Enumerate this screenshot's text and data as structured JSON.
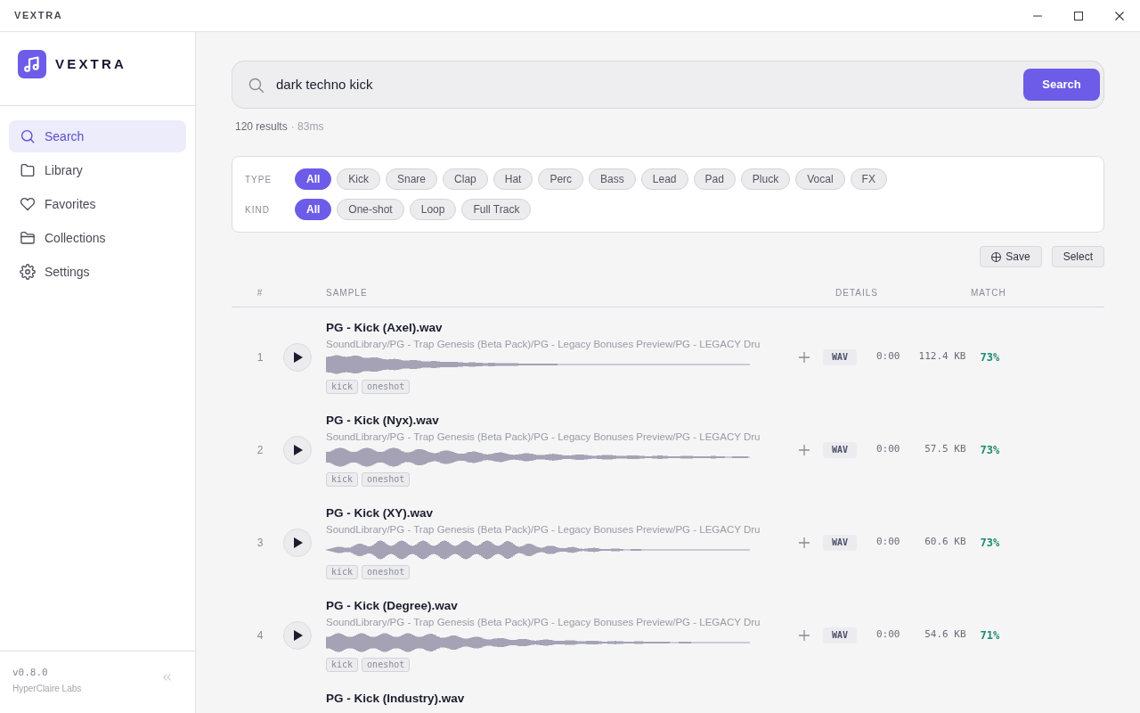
{
  "window": {
    "title": "VEXTRA"
  },
  "sidebar": {
    "brand": "VEXTRA",
    "items": [
      {
        "label": "Search",
        "selected": true
      },
      {
        "label": "Library",
        "selected": false
      },
      {
        "label": "Favorites",
        "selected": false
      },
      {
        "label": "Collections",
        "selected": false
      },
      {
        "label": "Settings",
        "selected": false
      }
    ],
    "version": "v0.8.0",
    "company": "HyperClaire Labs"
  },
  "search": {
    "value": "dark techno kick",
    "button": "Search",
    "results": "120 results",
    "elapsed": "· 83ms"
  },
  "filters": [
    {
      "label": "TYPE",
      "chips": [
        {
          "label": "All",
          "selected": true
        },
        {
          "label": "Kick",
          "selected": false
        },
        {
          "label": "Snare",
          "selected": false
        },
        {
          "label": "Clap",
          "selected": false
        },
        {
          "label": "Hat",
          "selected": false
        },
        {
          "label": "Perc",
          "selected": false
        },
        {
          "label": "Bass",
          "selected": false
        },
        {
          "label": "Lead",
          "selected": false
        },
        {
          "label": "Pad",
          "selected": false
        },
        {
          "label": "Pluck",
          "selected": false
        },
        {
          "label": "Vocal",
          "selected": false
        },
        {
          "label": "FX",
          "selected": false
        }
      ]
    },
    {
      "label": "KIND",
      "chips": [
        {
          "label": "All",
          "selected": true
        },
        {
          "label": "One-shot",
          "selected": false
        },
        {
          "label": "Loop",
          "selected": false
        },
        {
          "label": "Full Track",
          "selected": false
        }
      ]
    }
  ],
  "actions": [
    {
      "label": "Save",
      "kind": "icon"
    },
    {
      "label": "Select",
      "kind": "text"
    }
  ],
  "table": {
    "columns": [
      "#",
      "SAMPLE",
      "DETAILS",
      "MATCH"
    ],
    "rows": [
      {
        "number": "1",
        "name": "PG - Kick (Axel).wav",
        "path": "SoundLibrary/PG - Trap Genesis (Beta Pack)/PG - Legacy Bonuses Preview/PG - LEGACY Dru",
        "tags": [
          "kick",
          "oneshot"
        ],
        "format": "WAV",
        "duration": "0:00",
        "size": "112.4 KB",
        "match": "73%"
      },
      {
        "number": "2",
        "name": "PG - Kick (Nyx).wav",
        "path": "SoundLibrary/PG - Trap Genesis (Beta Pack)/PG - Legacy Bonuses Preview/PG - LEGACY Dru",
        "tags": [
          "kick",
          "oneshot"
        ],
        "format": "WAV",
        "duration": "0:00",
        "size": "57.5 KB",
        "match": "73%"
      },
      {
        "number": "3",
        "name": "PG - Kick (XY).wav",
        "path": "SoundLibrary/PG - Trap Genesis (Beta Pack)/PG - Legacy Bonuses Preview/PG - LEGACY Dru",
        "tags": [
          "kick",
          "oneshot"
        ],
        "format": "WAV",
        "duration": "0:00",
        "size": "60.6 KB",
        "match": "73%"
      },
      {
        "number": "4",
        "name": "PG - Kick (Degree).wav",
        "path": "SoundLibrary/PG - Trap Genesis (Beta Pack)/PG - Legacy Bonuses Preview/PG - LEGACY Dru",
        "tags": [
          "kick",
          "oneshot"
        ],
        "format": "WAV",
        "duration": "0:00",
        "size": "54.6 KB",
        "match": "71%"
      },
      {
        "name": "PG - Kick (Industry).wav"
      }
    ]
  }
}
